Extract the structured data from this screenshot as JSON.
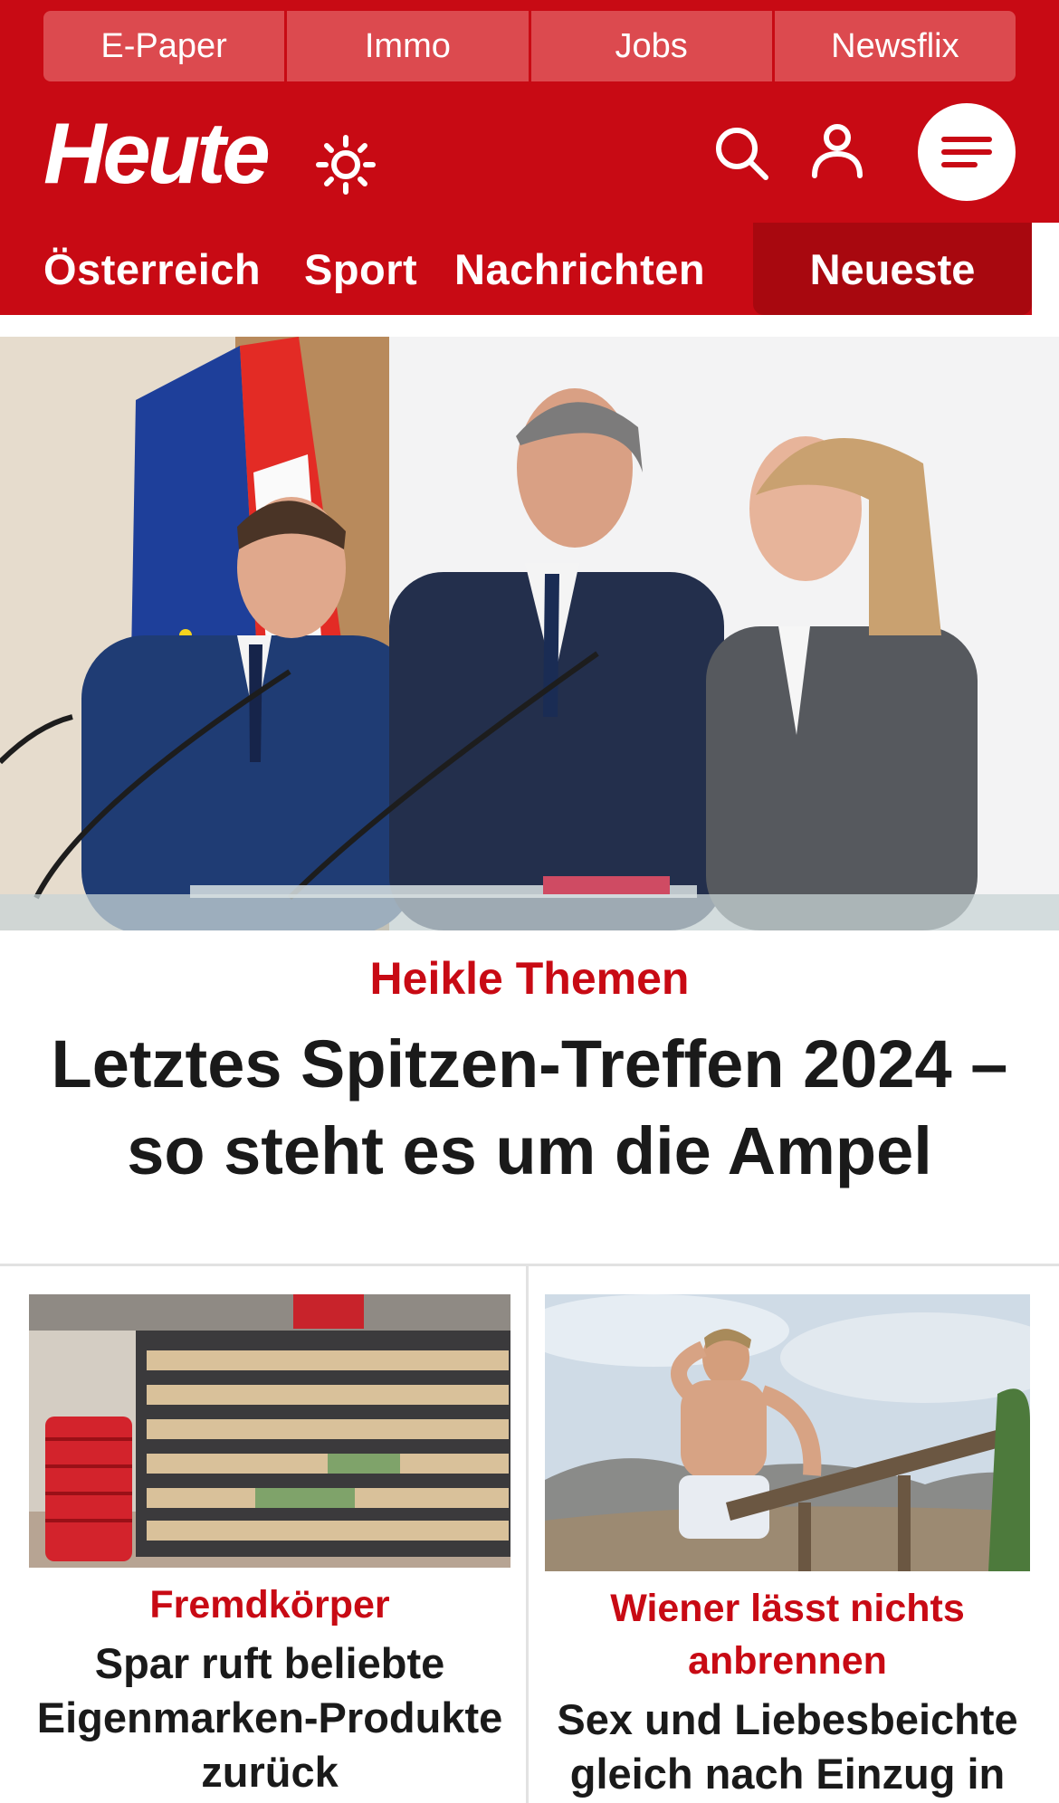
{
  "topbar": {
    "items": [
      {
        "label": "E-Paper"
      },
      {
        "label": "Immo"
      },
      {
        "label": "Jobs"
      },
      {
        "label": "Newsflix"
      }
    ]
  },
  "header": {
    "logo": "Heute",
    "icons": [
      "sun-icon",
      "search-icon",
      "user-icon",
      "menu-icon"
    ],
    "brand_color": "#c80a14"
  },
  "nav": {
    "items": [
      {
        "label": "Österreich"
      },
      {
        "label": "Sport"
      },
      {
        "label": "Nachrichten"
      }
    ],
    "active": {
      "label": "Neueste"
    }
  },
  "hero": {
    "kicker": "Heikle Themen",
    "title": "Letztes Spitzen-Treffen 2024 – so steht es um die Ampel"
  },
  "cards": [
    {
      "kicker": "Fremdkörper",
      "title": "Spar ruft beliebte Eigenmarken-Produkte zurück"
    },
    {
      "kicker": "Wiener lässt nichts anbrennen",
      "title": "Sex und Liebesbeichte gleich nach Einzug in"
    }
  ]
}
